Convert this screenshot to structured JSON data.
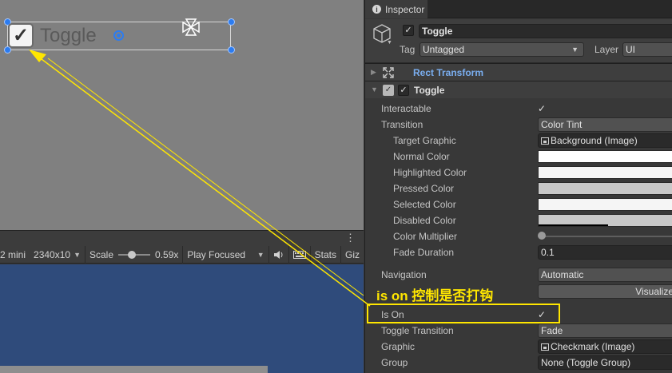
{
  "scene": {
    "toggle_label": "Toggle",
    "toggle_checkmark": "✓"
  },
  "game_toolbar": {
    "aspect": "2 mini",
    "resolution": "2340x10",
    "scale_label": "Scale",
    "scale_value": "0.59x",
    "play_mode": "Play Focused",
    "stats": "Stats",
    "gizmos": "Giz",
    "menu_glyph": "⋮",
    "dropdown_glyph": "▼"
  },
  "inspector": {
    "tab_label": "Inspector",
    "tab_icon": "info-icon",
    "gameobject": {
      "active_check": "✓",
      "name": "Toggle",
      "tag_label": "Tag",
      "tag_value": "Untagged",
      "layer_label": "Layer",
      "layer_value": "UI"
    },
    "components": {
      "rect_transform": {
        "title": "Rect Transform",
        "fold": "▶"
      },
      "toggle": {
        "title": "Toggle",
        "fold": "▼",
        "enabled_check": "✓"
      }
    },
    "properties": {
      "interactable": {
        "label": "Interactable",
        "value": "✓"
      },
      "transition": {
        "label": "Transition",
        "value": "Color Tint"
      },
      "target_graphic": {
        "label": "Target Graphic",
        "value": "Background (Image)"
      },
      "normal_color": {
        "label": "Normal Color",
        "color": "#ffffff"
      },
      "highlighted_color": {
        "label": "Highlighted Color",
        "color": "#f5f5f5"
      },
      "pressed_color": {
        "label": "Pressed Color",
        "color": "#c8c8c8"
      },
      "selected_color": {
        "label": "Selected Color",
        "color": "#f5f5f5"
      },
      "disabled_color": {
        "label": "Disabled Color",
        "color": "#c8c8c8",
        "alpha": 0.5
      },
      "color_multiplier": {
        "label": "Color Multiplier",
        "value": 1
      },
      "fade_duration": {
        "label": "Fade Duration",
        "value": "0.1"
      },
      "navigation": {
        "label": "Navigation",
        "value": "Automatic",
        "visualize": "Visualize"
      },
      "is_on": {
        "label": "Is On",
        "value": "✓"
      },
      "toggle_transition": {
        "label": "Toggle Transition",
        "value": "Fade"
      },
      "graphic": {
        "label": "Graphic",
        "value": "Checkmark (Image)"
      },
      "group": {
        "label": "Group",
        "value": "None (Toggle Group)"
      }
    }
  },
  "annotation": {
    "text": "is on 控制是否打钩",
    "color": "#ffe600"
  }
}
